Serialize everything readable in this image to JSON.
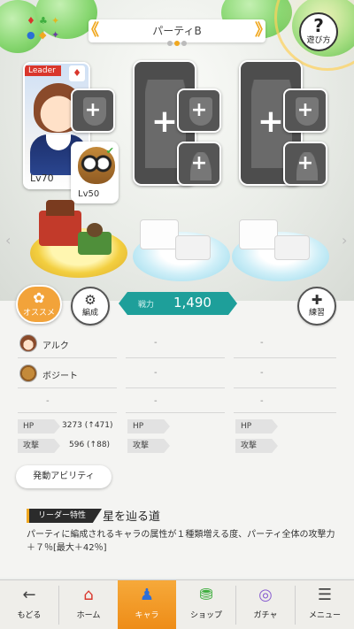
{
  "header": {
    "party_title": "パーティB",
    "help_label": "遊び方",
    "help_glyph": "?",
    "prev_arrow": "《",
    "next_arrow": "》"
  },
  "slots": {
    "leader": {
      "tag": "Leader",
      "level": "Lv70",
      "name": "アルク"
    },
    "support": {
      "level": "Lv50",
      "name": "ボジート"
    }
  },
  "actions": {
    "recommend_label": "オススメ",
    "formation_label": "編成",
    "practice_label": "練習"
  },
  "power": {
    "label": "戦力",
    "value": "1,490"
  },
  "party_table": {
    "row1": [
      "アルク",
      "-",
      "-"
    ],
    "row2": [
      "ボジート",
      "-",
      "-"
    ],
    "row3": [
      "-",
      "-",
      "-"
    ]
  },
  "stats": {
    "hp_label": "HP",
    "atk_label": "攻撃",
    "col1_hp": "3273 (↑471)",
    "col1_atk": "596 (↑88)"
  },
  "ability_button": "発動アビリティ",
  "leader_skill": {
    "tag": "リーダー特性",
    "name": "星を辿る道",
    "desc": "パーティに編成されるキャラの属性が１種類増える度、パーティ全体の攻撃力＋７％[最大＋42％]"
  },
  "nav": [
    {
      "label": "もどる",
      "icon": "←"
    },
    {
      "label": "ホーム",
      "icon": "⌂"
    },
    {
      "label": "キャラ",
      "icon": "♟"
    },
    {
      "label": "ショップ",
      "icon": "⛃"
    },
    {
      "label": "ガチャ",
      "icon": "◎"
    },
    {
      "label": "メニュー",
      "icon": "☰"
    }
  ],
  "colors": {
    "accent": "#f0a820",
    "power_teal": "#1e9f9a",
    "leader_red": "#d9362c"
  }
}
